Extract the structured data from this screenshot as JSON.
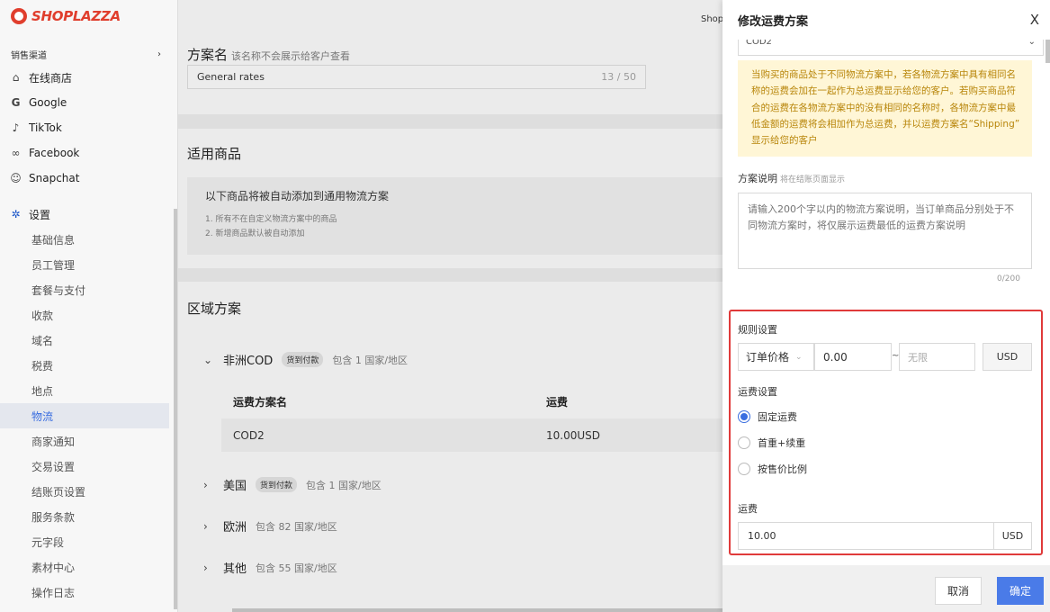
{
  "brand": {
    "name": "SHOPLAZZA"
  },
  "sidebar": {
    "section_label": "销售渠道",
    "section_chevron": "›",
    "channels": [
      {
        "label": "在线商店",
        "icon": "store-icon",
        "glyph": "⌂"
      },
      {
        "label": "Google",
        "icon": "google-icon",
        "glyph": "G"
      },
      {
        "label": "TikTok",
        "icon": "tiktok-icon",
        "glyph": "♪"
      },
      {
        "label": "Facebook",
        "icon": "meta-icon",
        "glyph": "∞"
      },
      {
        "label": "Snapchat",
        "icon": "snapchat-icon",
        "glyph": "☺"
      }
    ],
    "settings": {
      "label": "设置",
      "icon": "gear-icon",
      "glyph": "✲"
    },
    "sub_items": [
      "基础信息",
      "员工管理",
      "套餐与支付",
      "收款",
      "域名",
      "税费",
      "地点",
      "物流",
      "商家通知",
      "交易设置",
      "结账页设置",
      "服务条款",
      "元字段",
      "素材中心",
      "操作日志"
    ],
    "active_sub_item": "物流"
  },
  "main": {
    "plan_name_label": "方案名",
    "plan_name_hint": "该名称不会展示给客户查看",
    "plan_name_value": "General rates",
    "plan_name_count": "13 / 50",
    "applicable_title": "适用商品",
    "applicable_head": "以下商品将被自动添加到通用物流方案",
    "applicable_notes": [
      "1. 所有不在自定义物流方案中的商品",
      "2. 新增商品默认被自动添加"
    ],
    "zones_title": "区域方案",
    "zones": [
      {
        "name": "非洲COD",
        "badge": "货到付款",
        "count": "包含 1 国家/地区",
        "expanded": true
      },
      {
        "name": "美国",
        "badge": "货到付款",
        "count": "包含 1 国家/地区",
        "expanded": false
      },
      {
        "name": "欧洲",
        "badge": "",
        "count": "包含 82 国家/地区",
        "expanded": false
      },
      {
        "name": "其他",
        "badge": "",
        "count": "包含 55 国家/地区",
        "expanded": false
      }
    ],
    "rate_table": {
      "headers": [
        "运费方案名",
        "运费"
      ],
      "rows": [
        {
          "name": "COD2",
          "fee": "10.00USD"
        }
      ]
    },
    "shop_peek": "Shop"
  },
  "drawer": {
    "title": "修改运费方案",
    "close_glyph": "X",
    "select_value": "COD2",
    "notice": "当购买的商品处于不同物流方案中，若各物流方案中具有相同名称的运费会加在一起作为总运费显示给您的客户。若购买商品符合的运费在各物流方案中的没有相同的名称时，各物流方案中最低金额的运费将会相加作为总运费，并以运费方案名“Shipping” 显示给您的客户",
    "desc_label": "方案说明",
    "desc_hint": "将在结账页面显示",
    "desc_placeholder": "请输入200个字以内的物流方案说明，当订单商品分别处于不同物流方案时，将仅展示运费最低的运费方案说明",
    "desc_count": "0/200",
    "rule_label": "规则设置",
    "condition": "订单价格",
    "min_value": "0.00",
    "range_sep": "~",
    "max_placeholder": "无限",
    "currency": "USD",
    "fee_setting_label": "运费设置",
    "fee_options": [
      {
        "label": "固定运费",
        "selected": true
      },
      {
        "label": "首重+续重",
        "selected": false
      },
      {
        "label": "按售价比例",
        "selected": false
      }
    ],
    "fee_label": "运费",
    "fee_value": "10.00",
    "fee_currency": "USD",
    "cancel_label": "取消",
    "confirm_label": "确定"
  },
  "colors": {
    "brand_red": "#e03e2d",
    "accent_blue": "#3a6ee0",
    "notice_bg": "#fff6d6",
    "highlight_red": "#e03a3a"
  }
}
